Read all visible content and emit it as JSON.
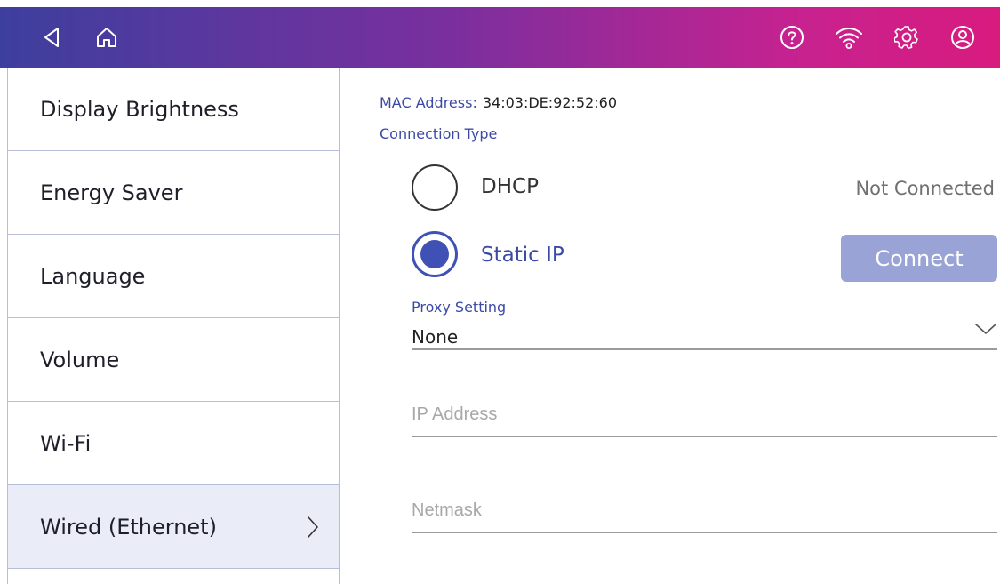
{
  "topbar": {
    "icons": [
      "back-icon",
      "home-icon",
      "help-icon",
      "wifi-icon",
      "settings-icon",
      "account-icon"
    ]
  },
  "sidebar": {
    "items": [
      {
        "label": "Display Brightness"
      },
      {
        "label": "Energy Saver"
      },
      {
        "label": "Language"
      },
      {
        "label": "Volume"
      },
      {
        "label": "Wi-Fi"
      },
      {
        "label": "Wired (Ethernet)",
        "active": true
      }
    ]
  },
  "main": {
    "mac_label": "MAC Address:",
    "mac_value": "34:03:DE:92:52:60",
    "connection_type_label": "Connection Type",
    "options": [
      {
        "label": "DHCP",
        "selected": false
      },
      {
        "label": "Static IP",
        "selected": true
      }
    ],
    "status": "Not Connected",
    "connect_label": "Connect",
    "proxy_label": "Proxy Setting",
    "proxy_value": "None",
    "ip_placeholder": "IP Address",
    "netmask_placeholder": "Netmask"
  },
  "colors": {
    "accent": "#3f51b5",
    "gradient_start": "#3d3f9e",
    "gradient_end": "#d81b7e",
    "button": "#9aa3d6"
  }
}
